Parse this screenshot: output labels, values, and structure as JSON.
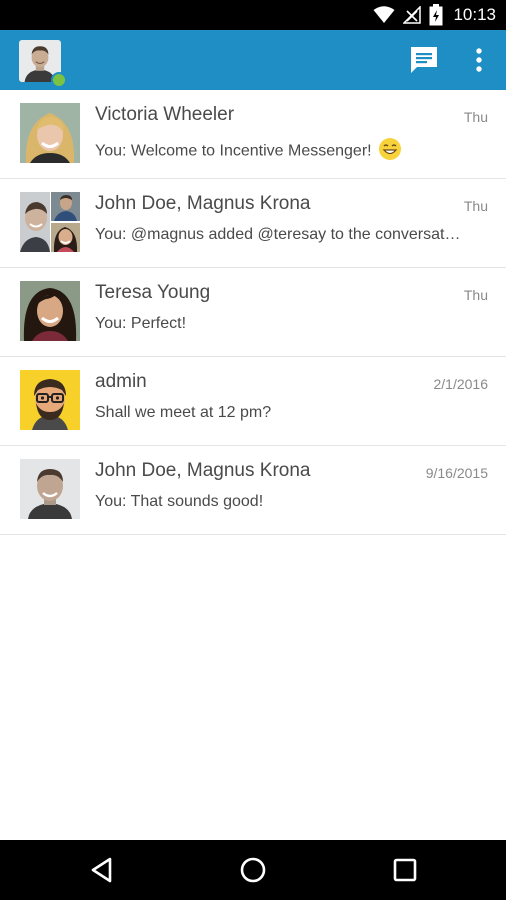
{
  "status_bar": {
    "time": "10:13",
    "icons": [
      "wifi-icon",
      "no-signal-icon",
      "battery-charging-icon"
    ]
  },
  "app_bar": {
    "accent_color": "#1f8ec4",
    "presence_color": "#7bc242",
    "actions": [
      "compose-message-icon",
      "overflow-menu-icon"
    ]
  },
  "conversations": [
    {
      "name": "Victoria Wheeler",
      "date": "Thu",
      "preview": "You: Welcome to Incentive Messenger!",
      "emoji": "smiling-emoji-icon"
    },
    {
      "name": "John Doe, Magnus Krona",
      "date": "Thu",
      "preview": "You: @magnus added @teresay to the conversat…"
    },
    {
      "name": "Teresa Young",
      "date": "Thu",
      "preview": "You: Perfect!"
    },
    {
      "name": "admin",
      "date": "2/1/2016",
      "preview": "Shall we meet at 12 pm?"
    },
    {
      "name": "John Doe, Magnus Krona",
      "date": "9/16/2015",
      "preview": "You: That sounds good!"
    }
  ],
  "nav_bar": {
    "buttons": [
      "back-icon",
      "home-icon",
      "recents-icon"
    ]
  }
}
